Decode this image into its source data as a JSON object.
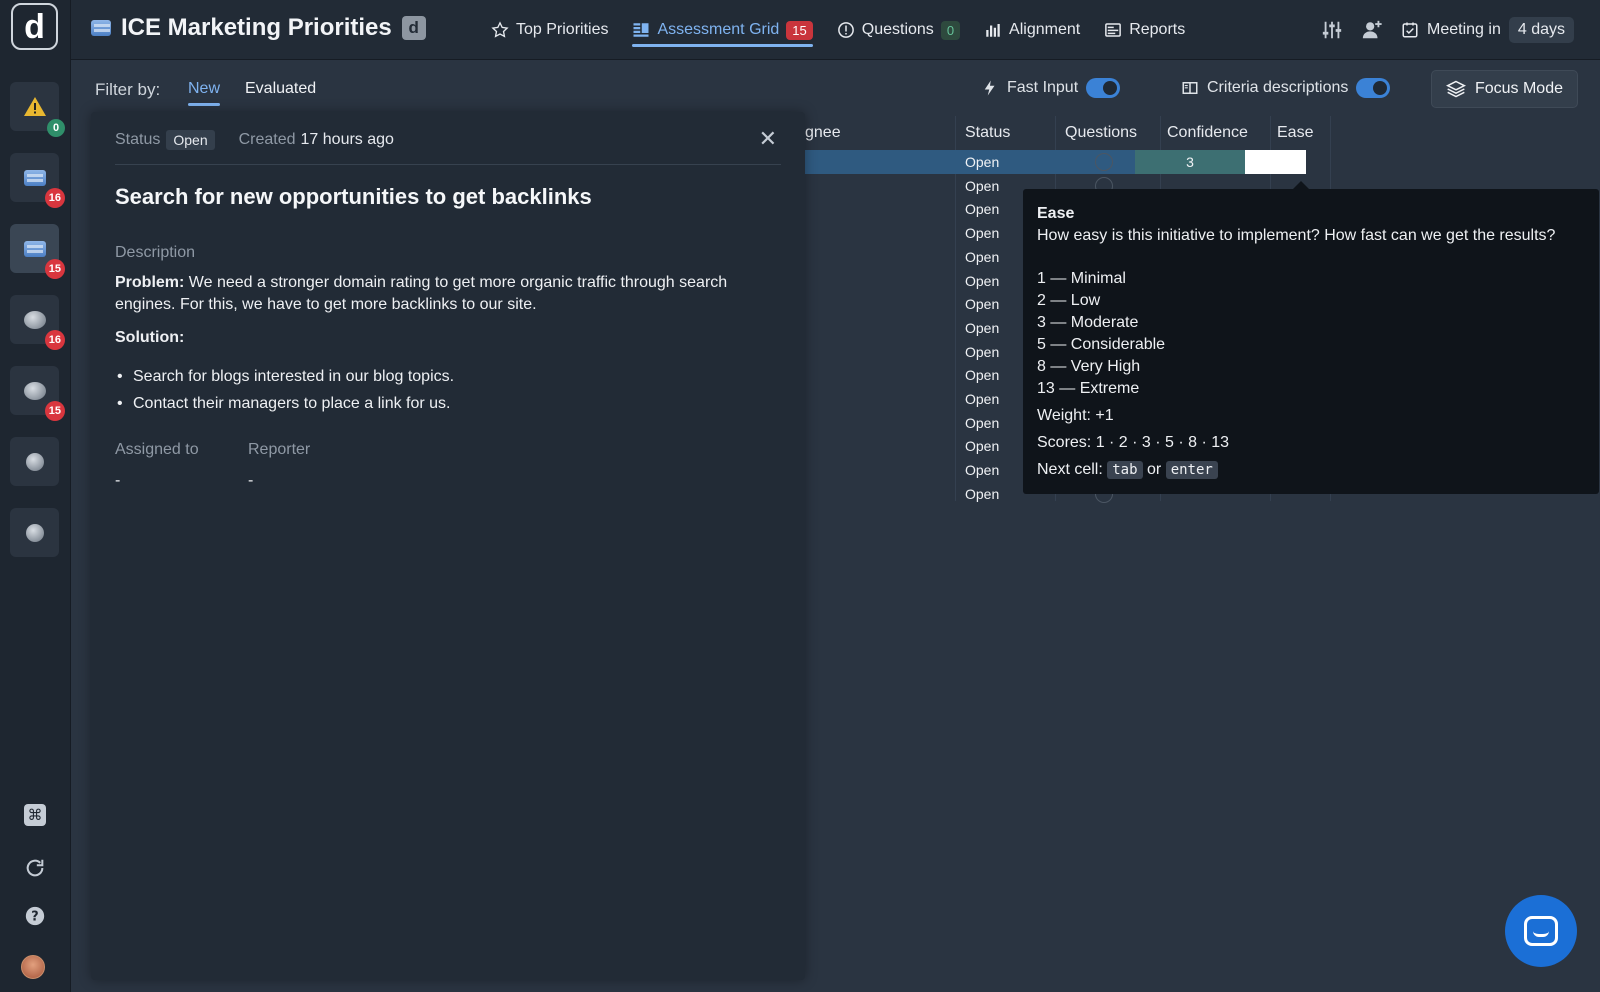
{
  "app": {
    "logo_letter": "d",
    "title": "ICE Marketing Priorities",
    "title_badge": "d"
  },
  "nav": [
    {
      "label": "Top Priorities",
      "icon": "star-icon"
    },
    {
      "label": "Assessment Grid",
      "icon": "grid-icon",
      "count": "15",
      "active": true
    },
    {
      "label": "Questions",
      "icon": "question-icon",
      "count": "0"
    },
    {
      "label": "Alignment",
      "icon": "alignment-icon"
    },
    {
      "label": "Reports",
      "icon": "reports-icon"
    }
  ],
  "meeting": {
    "label": "Meeting in",
    "value": "4 days"
  },
  "sidebar": {
    "items": [
      {
        "icon": "warning-icon",
        "badge": "0"
      },
      {
        "icon": "board-icon",
        "badge": "16"
      },
      {
        "icon": "board-icon",
        "badge": "15",
        "active": true
      },
      {
        "icon": "orb-icon",
        "badge": "16"
      },
      {
        "icon": "orb-icon",
        "badge": "15"
      },
      {
        "icon": "stopwatch-icon"
      },
      {
        "icon": "stopwatch-icon"
      }
    ],
    "utils": [
      "command-icon",
      "refresh-icon",
      "help-icon"
    ]
  },
  "filter": {
    "label": "Filter by:",
    "tabs": [
      "New",
      "Evaluated"
    ],
    "fast_input": "Fast Input",
    "criteria_desc": "Criteria descriptions",
    "focus_mode": "Focus Mode"
  },
  "grid": {
    "headers": {
      "assignee": "gnee",
      "status": "Status",
      "questions": "Questions",
      "confidence": "Confidence",
      "ease": "Ease"
    },
    "rows": [
      "Open",
      "Open",
      "Open",
      "Open",
      "Open",
      "Open",
      "Open",
      "Open",
      "Open",
      "Open",
      "Open",
      "Open",
      "Open",
      "Open",
      "Open"
    ],
    "selected_confidence": "3"
  },
  "detail": {
    "status_label": "Status",
    "status_value": "Open",
    "created_label": "Created",
    "created_value": "17 hours ago",
    "title": "Search for new opportunities to get backlinks",
    "description_label": "Description",
    "problem_label": "Problem:",
    "problem_text": "We need a stronger domain rating to get more organic traffic through search engines. For this, we have to get more backlinks to our site.",
    "solution_label": "Solution:",
    "bullets": [
      "Search for blogs interested in our blog topics.",
      "Contact their managers to place a link for us."
    ],
    "assigned_label": "Assigned to",
    "assigned_value": "-",
    "reporter_label": "Reporter",
    "reporter_value": "-"
  },
  "tooltip": {
    "title": "Ease",
    "question": "How easy is this initiative to implement? How fast can we get the results?",
    "scale": [
      "1 — Minimal",
      "2 — Low",
      "3 — Moderate",
      "5 — Considerable",
      "8 — Very High",
      "13 — Extreme"
    ],
    "weight": "Weight: +1",
    "scores": "Scores: 1 · 2 · 3 · 5 · 8 · 13",
    "next_cell": "Next cell:",
    "key_tab": "tab",
    "or": "or",
    "key_enter": "enter"
  },
  "colors": {
    "accent": "#7fb3f0",
    "badge_red": "#d9363e",
    "chat_blue": "#1b6fd6"
  }
}
